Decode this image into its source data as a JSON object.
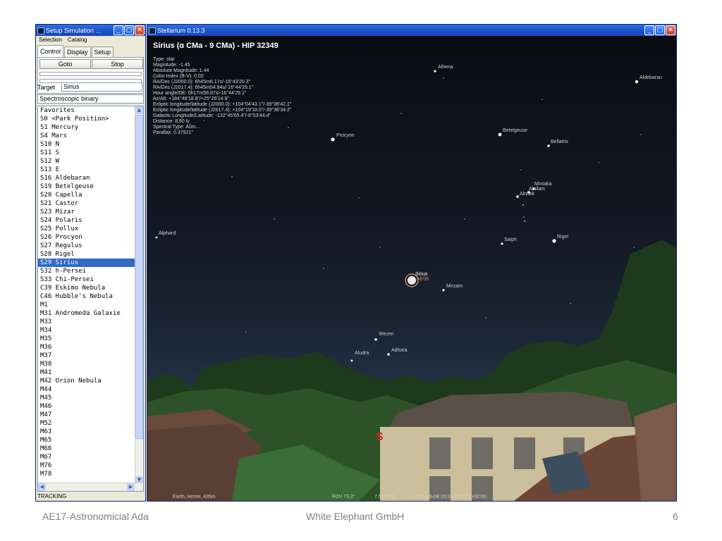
{
  "setup_window": {
    "title": "Setup Simulation ...",
    "menu": [
      "Selection",
      "Catalog"
    ],
    "tabs": [
      {
        "label": "Control",
        "active": true
      },
      {
        "label": "Display",
        "active": false
      },
      {
        "label": "Setup",
        "active": false
      }
    ],
    "goto_label": "Goto",
    "stop_label": "Stop",
    "target_label": "Target",
    "target_value": "Sirius",
    "spectral_value": "Spectroscopic binary",
    "favorites": [
      "Favorites",
      "S0 <Park Position>",
      "S1  Mercury",
      "S4  Mars",
      "S10 N",
      "S11 S",
      "S12 W",
      "S13 E",
      "S16 Aldebaran",
      "S19 Betelgeuse",
      "S20 Capella",
      "S21 Castor",
      "S23 Mizar",
      "S24 Polaris",
      "S25 Pollux",
      "S26 Procyon",
      "S27 Regulus",
      "S28 Rigel",
      "S29 Sirius",
      "S32 h-Persei",
      "S33 Chi-Persei",
      "C39 Eskimo Nebula",
      "C46 Hubble's Nebula",
      "M1",
      "M31 Andromeda Galaxie",
      "M33",
      "M34",
      "M35",
      "M36",
      "M37",
      "M38",
      "M41",
      "M42 Orion Nebula",
      "M44",
      "M45",
      "M46",
      "M47",
      "M52",
      "M63",
      "M65",
      "M66",
      "M67",
      "M76",
      "M78"
    ],
    "selected_favorite": "S29 Sirius",
    "status_text": "TRACKING"
  },
  "stellarium_window": {
    "title": "Stellarium 0.13.3",
    "info_title": "Sirius (α CMa - 9 CMa) - HIP 32349",
    "info_lines": [
      "Type: star",
      "Magnitude: -1.45",
      "Absolute Magnitude: 1.44",
      "Color Index (B-V): 0.00",
      "RA/Dec (J2000.0): 6h45m8.17s/-16°43'20.3\"",
      "RA/Dec (J2017.4): 6h45m54.94s/-16°44'29.1\"",
      "Hour angle/DE: 0h17m59.87s/-16°44'29.1\"",
      "Az/Alt: +184°46'18.8\"/+25°26'14.9\"",
      "Ecliptic longitude/latitude (J2000.0): +104°04'43.1\"/-39°36'42.1\"",
      "Ecliptic longitude/latitude (J2017.4): +104°19'18.0\"/-39°36'34.2\"",
      "Galactic Longitude/Latitude: -132°45'65.4\"/-8°53'44.4\"",
      "Distance: 8.60 ly",
      "Spectral Type: A0m...",
      "Parallax: 0.37921\""
    ],
    "star_labels": [
      "Alhena",
      "Aldebaran",
      "Procyon",
      "Betelgeuse",
      "Bellatrix",
      "Mintaka",
      "Alnilam",
      "Alnitak",
      "Alphard",
      "Saiph",
      "Rigel",
      "Sirius",
      "Mirzam",
      "Wezen",
      "Adhara",
      "Aludra"
    ],
    "sirius_sub_label": "AE06",
    "cardinal": "S",
    "status": {
      "location": "Earth, Home, 435m",
      "fov": "FOV 73.2°",
      "fps": "7.58 FPS",
      "datetime": "2017-06-08   15:20:55 UTC+02:00"
    }
  },
  "footer": {
    "left": "AE17-Astronomicial Ada",
    "center": "White Elephant GmbH",
    "page": "6"
  }
}
